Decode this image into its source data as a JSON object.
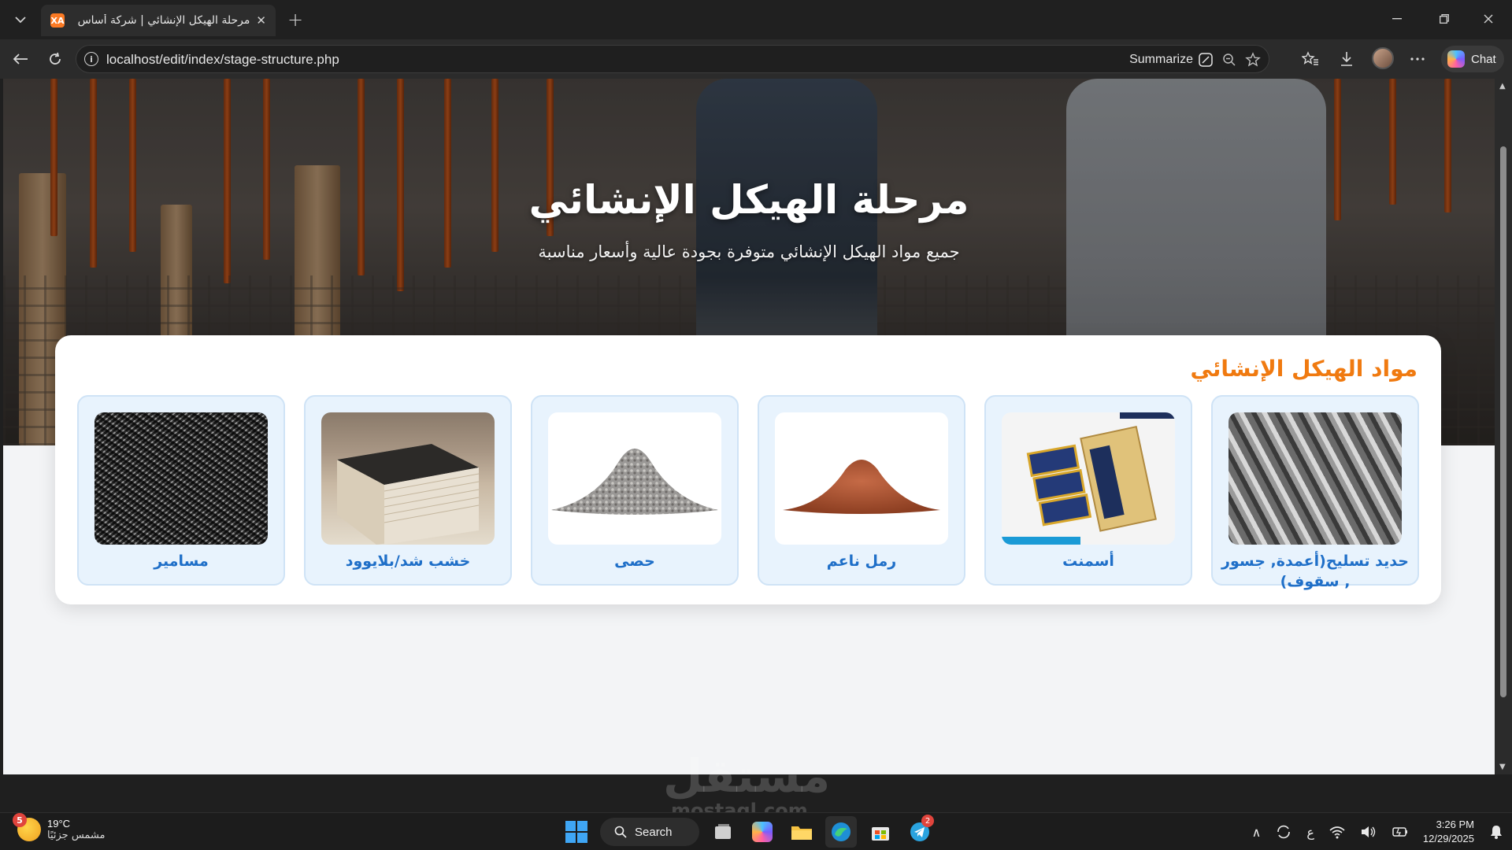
{
  "browser": {
    "tab_title": "مرحلة الهيكل الإنشائي | شركة أساس",
    "favicon_text": "XA",
    "tab_close": "✕",
    "new_tab": "+",
    "url": "localhost/edit/index/stage-structure.php",
    "summarize_label": "Summarize",
    "chat_label": "Chat"
  },
  "page": {
    "hero_title": "مرحلة الهيكل الإنشائي",
    "hero_subtitle": "جميع مواد الهيكل الإنشائي متوفرة بجودة عالية وأسعار مناسبة",
    "section_title": "مواد الهيكل الإنشائي",
    "materials": [
      {
        "label": "حديد تسليح(أعمدة, جسور , سقوف)",
        "image": "rebar-image"
      },
      {
        "label": "أسمنت",
        "image": "cement-image"
      },
      {
        "label": "رمل ناعم",
        "image": "sand-image"
      },
      {
        "label": "حصى",
        "image": "gravel-image"
      },
      {
        "label": "خشب شد/بلايوود",
        "image": "plywood-image"
      },
      {
        "label": "مسامير",
        "image": "nails-image"
      }
    ]
  },
  "taskbar": {
    "weather_temp": "19°C",
    "weather_desc": "مشمس جزئيًا",
    "weather_badge": "5",
    "search_label": "Search",
    "telegram_badge": "2",
    "time": "3:26 PM",
    "date": "12/29/2025",
    "lang": "ع"
  },
  "watermark": {
    "text": "مستقل",
    "sub": "mostaql.com"
  },
  "colors": {
    "accent_orange": "#f07a10",
    "card_label_blue": "#1f6fc8",
    "card_bg": "#e8f3fd"
  }
}
